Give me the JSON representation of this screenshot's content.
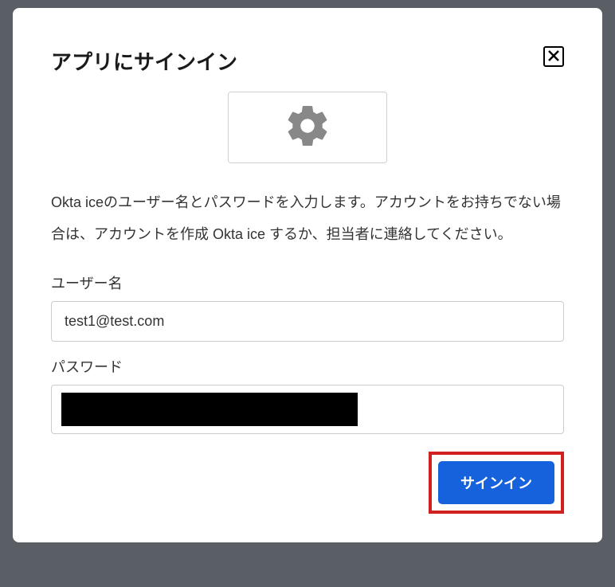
{
  "modal": {
    "title": "アプリにサインイン",
    "description": "Okta iceのユーザー名とパスワードを入力します。アカウントをお持ちでない場合は、アカウントを作成 Okta ice するか、担当者に連絡してください。",
    "username_label": "ユーザー名",
    "username_value": "test1@test.com",
    "password_label": "パスワード",
    "signin_button": "サインイン"
  }
}
